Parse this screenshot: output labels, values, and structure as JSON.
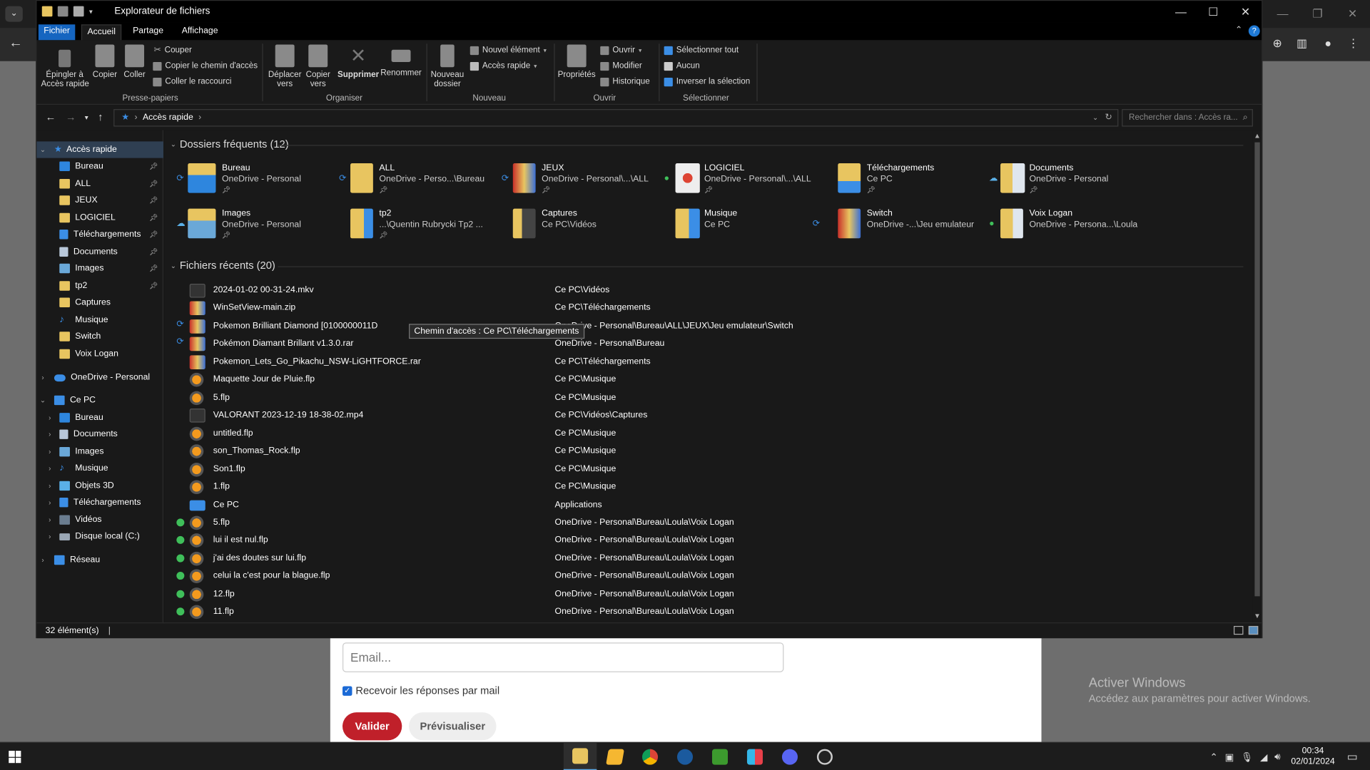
{
  "explorer": {
    "title": "Explorateur de fichiers",
    "menu_tabs": [
      "Fichier",
      "Accueil",
      "Partage",
      "Affichage"
    ],
    "ribbon": {
      "pin_quick_access": "Épingler à\nAccès rapide",
      "copy": "Copier",
      "paste": "Coller",
      "cut": "Couper",
      "copy_path": "Copier le chemin d'accès",
      "paste_shortcut": "Coller le raccourci",
      "group_clipboard": "Presse-papiers",
      "move_to": "Déplacer\nvers",
      "copy_to": "Copier\nvers",
      "delete": "Supprimer",
      "rename": "Renommer",
      "group_organize": "Organiser",
      "new_folder": "Nouveau\ndossier",
      "new_item": "Nouvel élément",
      "quick_access": "Accès rapide",
      "group_new": "Nouveau",
      "properties": "Propriétés",
      "open": "Ouvrir",
      "modify": "Modifier",
      "history": "Historique",
      "group_open": "Ouvrir",
      "select_all": "Sélectionner tout",
      "select_none": "Aucun",
      "invert_selection": "Inverser la sélection",
      "group_select": "Sélectionner"
    },
    "address": "Accès rapide",
    "search_placeholder": "Rechercher dans : Accès ra...",
    "nav": {
      "quick_access": "Accès rapide",
      "quick_items": [
        "Bureau",
        "ALL",
        "JEUX",
        "LOGICIEL",
        "Téléchargements",
        "Documents",
        "Images",
        "tp2",
        "Captures",
        "Musique",
        "Switch",
        "Voix Logan"
      ],
      "onedrive": "OneDrive - Personal",
      "this_pc": "Ce PC",
      "pc_items": [
        "Bureau",
        "Documents",
        "Images",
        "Musique",
        "Objets 3D",
        "Téléchargements",
        "Vidéos",
        "Disque local (C:)"
      ],
      "network": "Réseau"
    },
    "frequent_title": "Dossiers fréquents (12)",
    "frequent": [
      {
        "name": "Bureau",
        "path": "OneDrive - Personal"
      },
      {
        "name": "ALL",
        "path": "OneDrive - Perso...\\Bureau"
      },
      {
        "name": "JEUX",
        "path": "OneDrive - Personal\\...\\ALL"
      },
      {
        "name": "LOGICIEL",
        "path": "OneDrive - Personal\\...\\ALL"
      },
      {
        "name": "Téléchargements",
        "path": "Ce PC"
      },
      {
        "name": "Documents",
        "path": "OneDrive - Personal"
      },
      {
        "name": "Images",
        "path": "OneDrive - Personal"
      },
      {
        "name": "tp2",
        "path": "...\\Quentin Rubrycki Tp2 ..."
      },
      {
        "name": "Captures",
        "path": "Ce PC\\Vidéos"
      },
      {
        "name": "Musique",
        "path": "Ce PC"
      },
      {
        "name": "Switch",
        "path": "OneDrive -...\\Jeu emulateur"
      },
      {
        "name": "Voix Logan",
        "path": "OneDrive - Persona...\\Loula"
      }
    ],
    "recent_title": "Fichiers récents (20)",
    "recent": [
      {
        "name": "2024-01-02 00-31-24.mkv",
        "loc": "Ce PC\\Vidéos"
      },
      {
        "name": "WinSetView-main.zip",
        "loc": "Ce PC\\Téléchargements"
      },
      {
        "name": "Pokemon Brilliant Diamond [0100000011D",
        "loc": "OneDrive - Personal\\Bureau\\ALL\\JEUX\\Jeu emulateur\\Switch"
      },
      {
        "name": "Pokémon Diamant Brillant v1.3.0.rar",
        "loc": "OneDrive - Personal\\Bureau"
      },
      {
        "name": "Pokemon_Lets_Go_Pikachu_NSW-LiGHTFORCE.rar",
        "loc": "Ce PC\\Téléchargements"
      },
      {
        "name": "Maquette Jour de Pluie.flp",
        "loc": "Ce PC\\Musique"
      },
      {
        "name": "5.flp",
        "loc": "Ce PC\\Musique"
      },
      {
        "name": "VALORANT   2023-12-19 18-38-02.mp4",
        "loc": "Ce PC\\Vidéos\\Captures"
      },
      {
        "name": "untitled.flp",
        "loc": "Ce PC\\Musique"
      },
      {
        "name": "son_Thomas_Rock.flp",
        "loc": "Ce PC\\Musique"
      },
      {
        "name": "Son1.flp",
        "loc": "Ce PC\\Musique"
      },
      {
        "name": "1.flp",
        "loc": "Ce PC\\Musique"
      },
      {
        "name": "Ce PC",
        "loc": "Applications"
      },
      {
        "name": "5.flp",
        "loc": "OneDrive - Personal\\Bureau\\Loula\\Voix Logan"
      },
      {
        "name": "lui il est nul.flp",
        "loc": "OneDrive - Personal\\Bureau\\Loula\\Voix Logan"
      },
      {
        "name": "j'ai des doutes sur lui.flp",
        "loc": "OneDrive - Personal\\Bureau\\Loula\\Voix Logan"
      },
      {
        "name": "celui la c'est pour la blague.flp",
        "loc": "OneDrive - Personal\\Bureau\\Loula\\Voix Logan"
      },
      {
        "name": "12.flp",
        "loc": "OneDrive - Personal\\Bureau\\Loula\\Voix Logan"
      },
      {
        "name": "11.flp",
        "loc": "OneDrive - Personal\\Bureau\\Loula\\Voix Logan"
      }
    ],
    "tooltip": "Chemin d'accès : Ce PC\\Téléchargements",
    "status": "32 élément(s)"
  },
  "webpage": {
    "email_placeholder": "Email...",
    "mail_checkbox": "Recevoir les réponses par mail",
    "validate": "Valider",
    "preview": "Prévisualiser"
  },
  "activation": {
    "title": "Activer Windows",
    "subtitle": "Accédez aux paramètres pour activer Windows."
  },
  "taskbar": {
    "time": "00:34",
    "date": "02/01/2024"
  },
  "colors": {
    "accent": "#1565c0",
    "folder": "#e8c560",
    "sync_blue": "#3b8ee6",
    "ok_green": "#3fbf5a"
  }
}
